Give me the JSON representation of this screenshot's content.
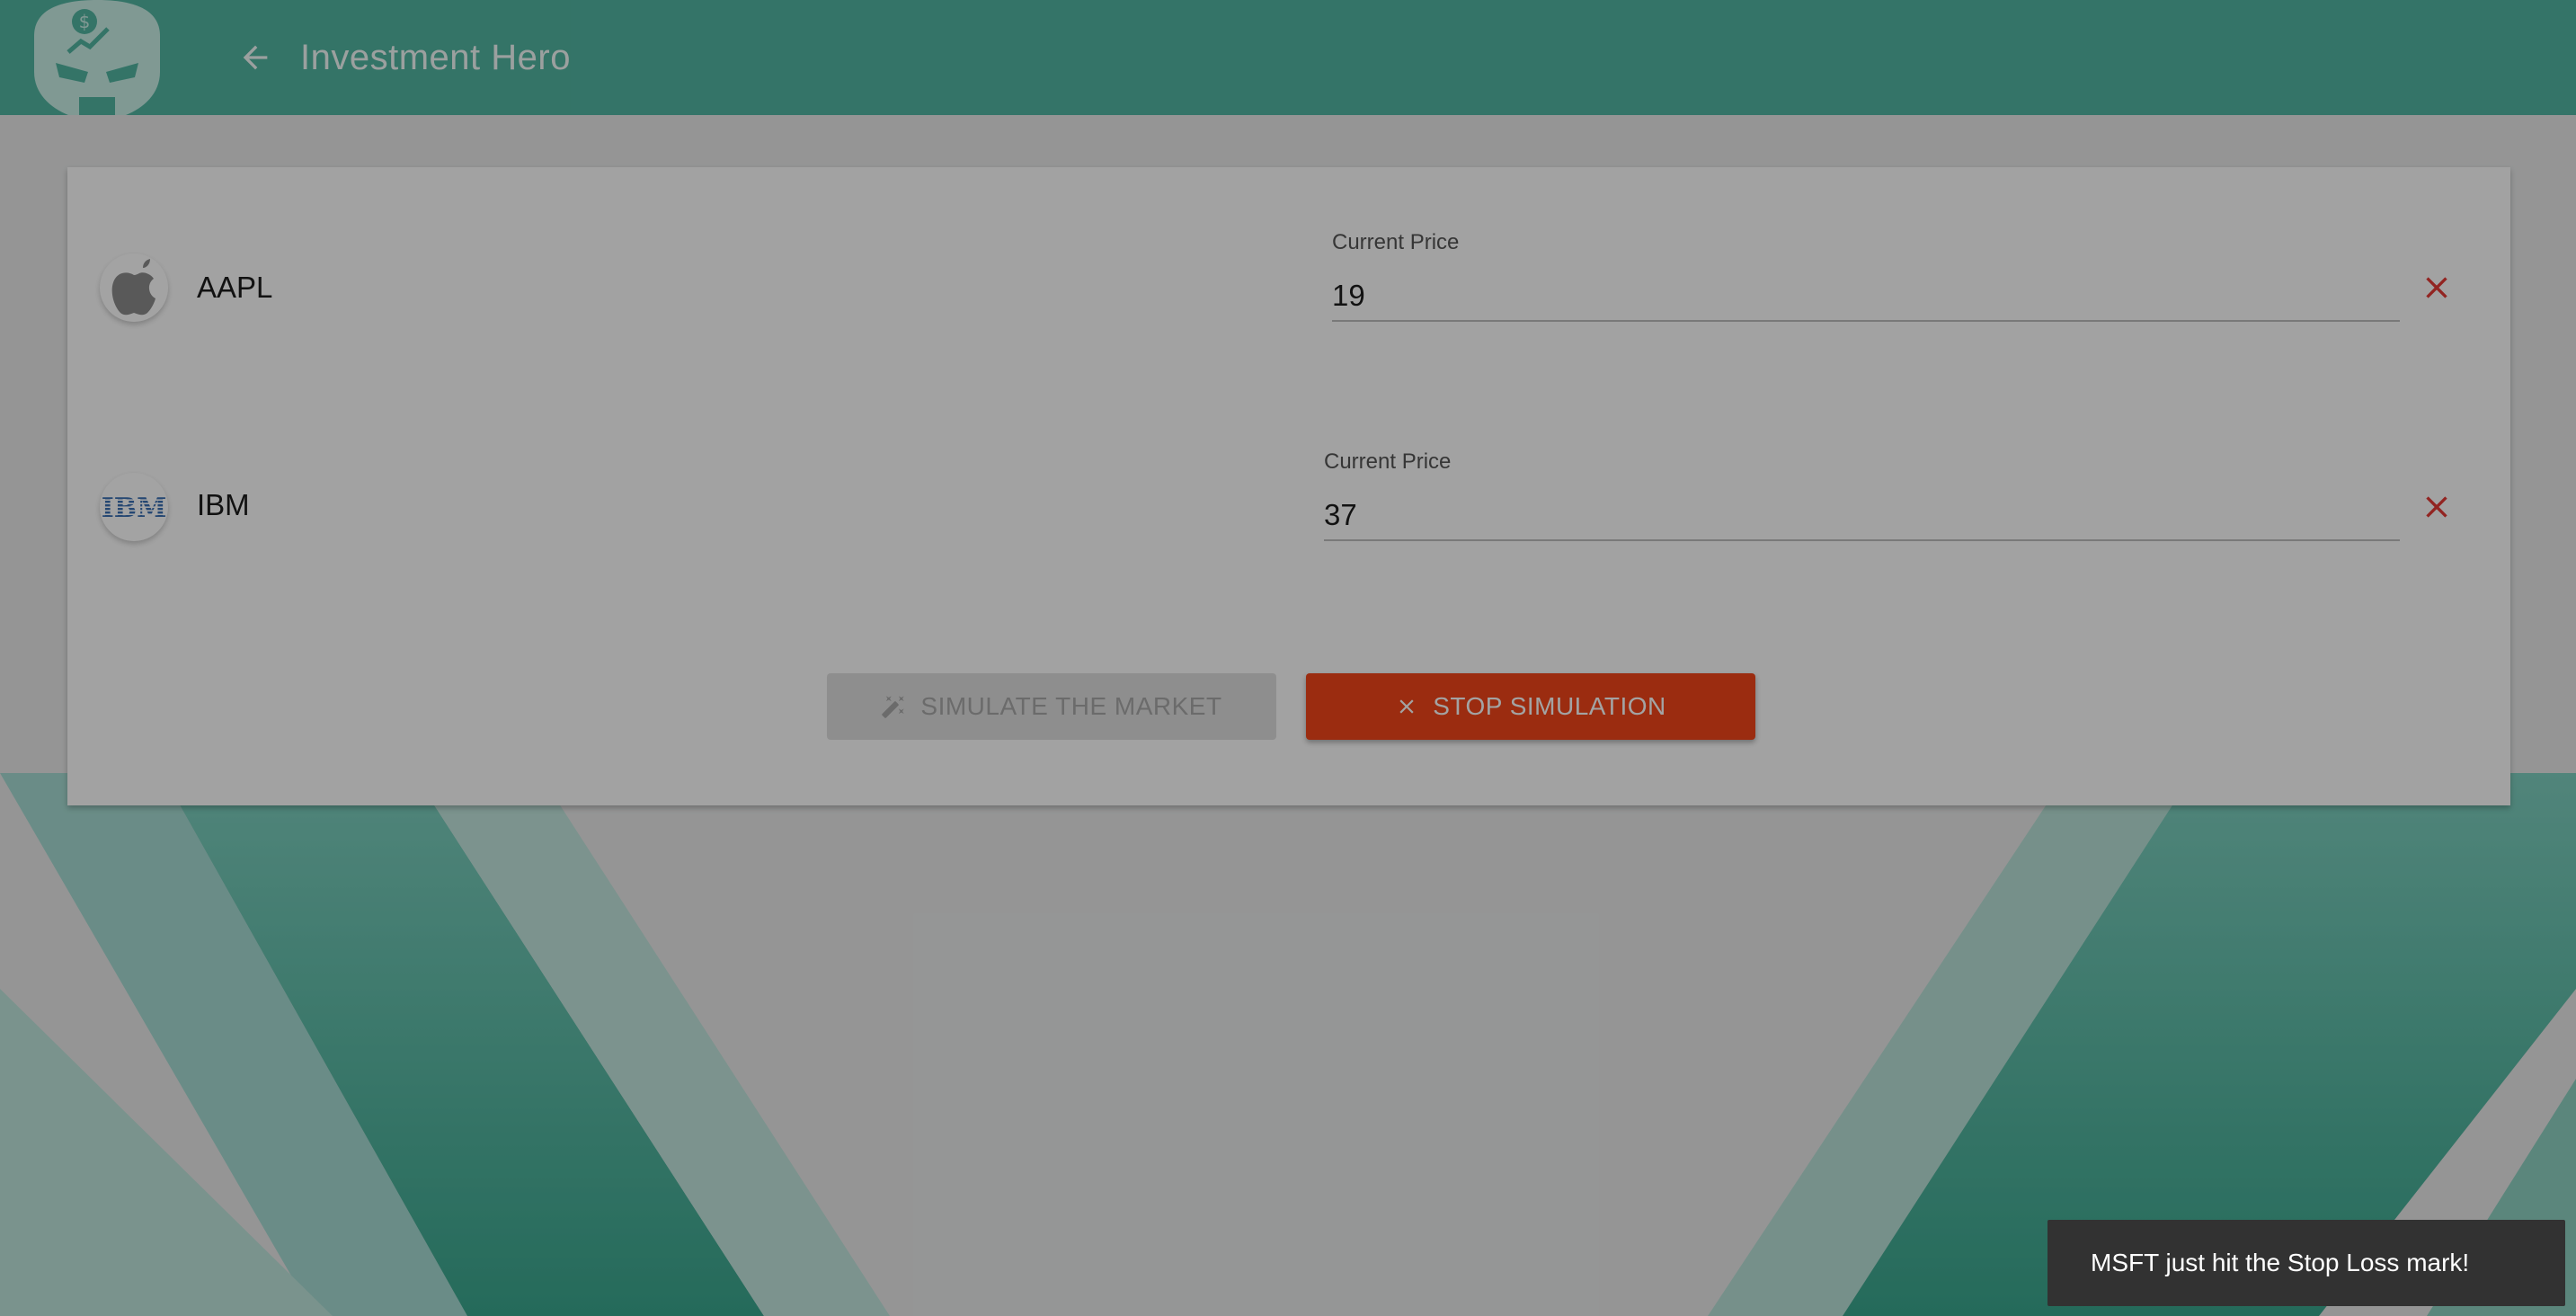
{
  "app": {
    "title": "Investment Hero",
    "accent_color": "#52b6a2",
    "logo_icon": "robot-hero-logo-icon",
    "back_icon": "arrow-left-icon"
  },
  "stocks": [
    {
      "ticker": "AAPL",
      "logo_icon": "apple-logo-icon",
      "price_label": "Current Price",
      "price_value": "19",
      "remove_icon": "close-icon"
    },
    {
      "ticker": "IBM",
      "logo_icon": "ibm-logo-icon",
      "logo_text": "IBM",
      "price_label": "Current Price",
      "price_value": "37",
      "remove_icon": "close-icon"
    }
  ],
  "actions": {
    "simulate_label": "SIMULATE THE MARKET",
    "simulate_icon": "magic-wand-icon",
    "simulate_disabled": true,
    "stop_label": "STOP SIMULATION",
    "stop_icon": "close-icon",
    "stop_color": "#f2461a"
  },
  "snackbar": {
    "message": "MSFT just hit the Stop Loss mark!"
  },
  "colors": {
    "remove_icon": "#e53935",
    "modal_scrim": "rgba(0,0,0,0.36)"
  }
}
